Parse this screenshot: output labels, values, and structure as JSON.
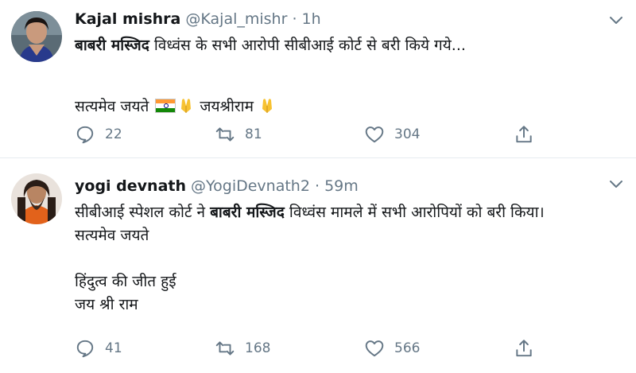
{
  "tweets": [
    {
      "display_name": "Kajal mishra",
      "handle": "@Kajal_mishr",
      "separator": "·",
      "time": "1h",
      "text_lines": [
        {
          "bold": "बाबरी मस्जिद",
          "rest": " विध्वंस के सभी आरोपी सीबीआई कोर्ट से बरी किये गये..."
        },
        {
          "bold": "",
          "rest": ""
        },
        {
          "bold": "",
          "rest": "सत्यमेव जयते",
          "emoji_after": [
            "indian-flag-emoji",
            "folded-hands-emoji"
          ],
          "rest2": " जयश्रीराम ",
          "emoji_end": [
            "folded-hands-emoji"
          ]
        }
      ],
      "counts": {
        "reply": "22",
        "retweet": "81",
        "like": "304"
      }
    },
    {
      "display_name": "yogi devnath",
      "handle": "@YogiDevnath2",
      "separator": "·",
      "time": "59m",
      "line1_prefix": "सीबीआई स्पेशल कोर्ट ने ",
      "line1_bold": "बाबरी मस्जिद",
      "line1_suffix": " विध्वंस मामले में सभी आरोपियों को बरी किया।",
      "line2": "सत्यमेव जयते",
      "line3": "हिंदुत्व की जीत हुई",
      "line4": "जय श्री राम",
      "counts": {
        "reply": "41",
        "retweet": "168",
        "like": "566"
      }
    }
  ],
  "colors": {
    "text": "#14171a",
    "secondary": "#657786",
    "divider": "#e6ecf0"
  }
}
